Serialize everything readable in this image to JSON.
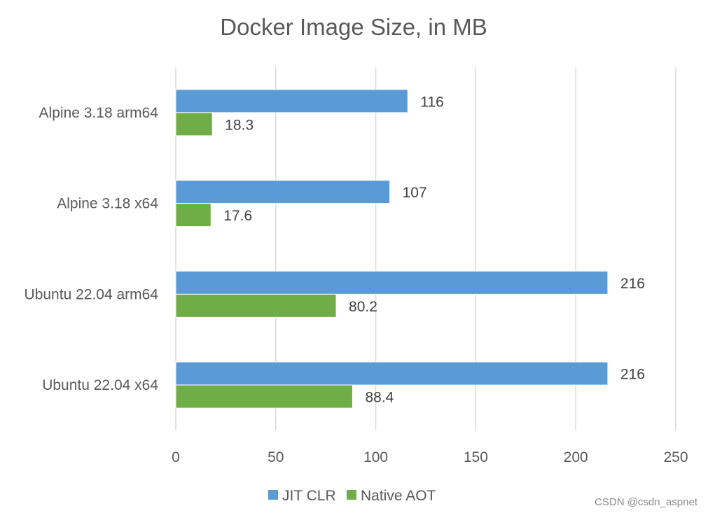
{
  "chart_data": {
    "type": "bar",
    "orientation": "horizontal",
    "title": "Docker Image Size, in MB",
    "xlabel": "",
    "ylabel": "",
    "categories": [
      "Alpine 3.18 arm64",
      "Alpine 3.18 x64",
      "Ubuntu 22.04 arm64",
      "Ubuntu 22.04 x64"
    ],
    "series": [
      {
        "name": "JIT CLR",
        "color": "#5B9BD5",
        "values": [
          116,
          107,
          216,
          216
        ],
        "labels": [
          "116",
          "107",
          "216",
          "216"
        ]
      },
      {
        "name": "Native AOT",
        "color": "#70AD47",
        "values": [
          18.3,
          17.6,
          80.2,
          88.4
        ],
        "labels": [
          "18.3",
          "17.6",
          "80.2",
          "88.4"
        ]
      }
    ],
    "xlim": [
      0,
      250
    ],
    "xticks": [
      0,
      50,
      100,
      150,
      200,
      250
    ],
    "grid": true,
    "legend": "bottom"
  },
  "watermark": "CSDN @csdn_aspnet"
}
